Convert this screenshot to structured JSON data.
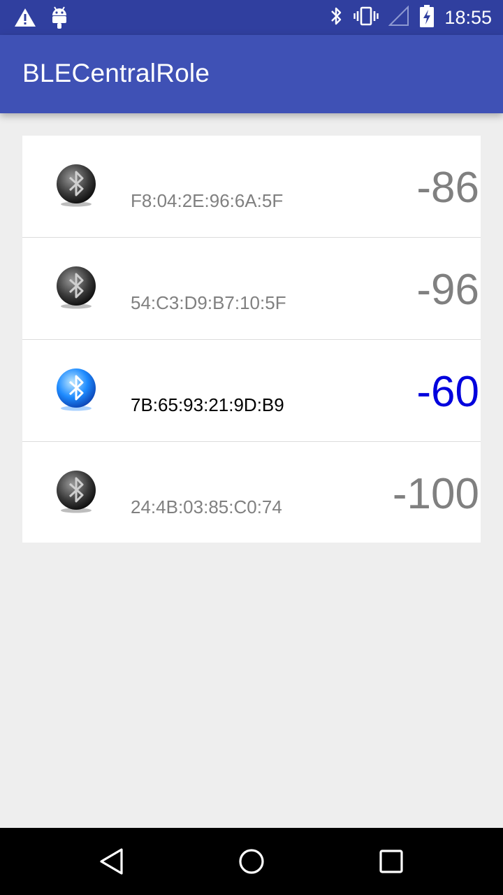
{
  "status_bar": {
    "time": "18:55",
    "left_icons": [
      "warning-icon",
      "android-debug-icon"
    ],
    "right_icons": [
      "bluetooth-icon",
      "vibrate-icon",
      "no-signal-icon",
      "battery-charging-icon"
    ]
  },
  "app_bar": {
    "title": "BLECentralRole"
  },
  "colors": {
    "status_bar": "#303f9f",
    "app_bar": "#3f51b5",
    "active_rssi": "#0000dd",
    "inactive": "#808080"
  },
  "devices": [
    {
      "mac": "F8:04:2E:96:6A:5F",
      "rssi": "-86",
      "active": false
    },
    {
      "mac": "54:C3:D9:B7:10:5F",
      "rssi": "-96",
      "active": false
    },
    {
      "mac": "7B:65:93:21:9D:B9",
      "rssi": "-60",
      "active": true
    },
    {
      "mac": "24:4B:03:85:C0:74",
      "rssi": "-100",
      "active": false
    }
  ],
  "nav_bar": {
    "icons": [
      "back-icon",
      "home-icon",
      "recents-icon"
    ]
  }
}
